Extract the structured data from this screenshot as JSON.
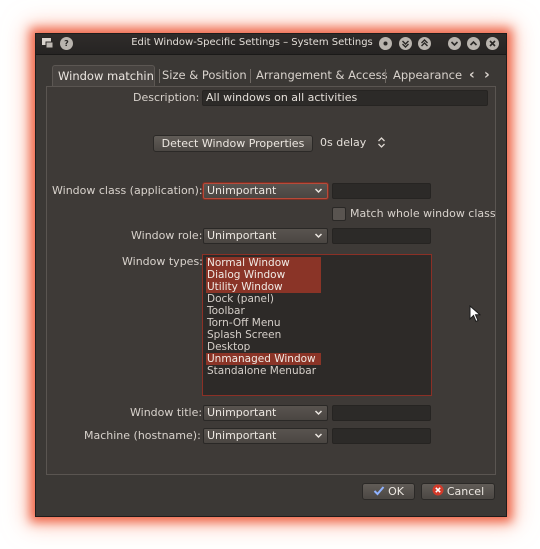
{
  "window": {
    "title": "Edit Window-Specific Settings – System Settings",
    "help_icon": "?"
  },
  "tabs": [
    "Window matching",
    "Size & Position",
    "Arrangement & Access",
    "Appearance &"
  ],
  "tab_scroll": {
    "left": "‹",
    "right": "›"
  },
  "form": {
    "description_label": "Description:",
    "description_value": "All windows on all activities",
    "detect_button": "Detect Window Properties",
    "delay_value": "0s delay",
    "window_class_label": "Window class (application):",
    "window_class_value": "Unimportant",
    "match_whole_class_label": "Match whole window class",
    "window_role_label": "Window role:",
    "window_role_value": "Unimportant",
    "window_types_label": "Window types:",
    "window_types": [
      {
        "label": "Normal Window",
        "selected": true
      },
      {
        "label": "Dialog Window",
        "selected": true
      },
      {
        "label": "Utility Window",
        "selected": true
      },
      {
        "label": "Dock (panel)",
        "selected": false
      },
      {
        "label": "Toolbar",
        "selected": false
      },
      {
        "label": "Torn-Off Menu",
        "selected": false
      },
      {
        "label": "Splash Screen",
        "selected": false
      },
      {
        "label": "Desktop",
        "selected": false
      },
      {
        "label": "Unmanaged Window",
        "selected": true
      },
      {
        "label": "Standalone Menubar",
        "selected": false
      }
    ],
    "window_title_label": "Window title:",
    "window_title_value": "Unimportant",
    "machine_label": "Machine (hostname):",
    "machine_value": "Unimportant"
  },
  "footer": {
    "ok_label": "OK",
    "cancel_label": "Cancel"
  },
  "colors": {
    "accent": "#8a3427",
    "glow": "#eb5a3c",
    "background": "#3b3835"
  }
}
